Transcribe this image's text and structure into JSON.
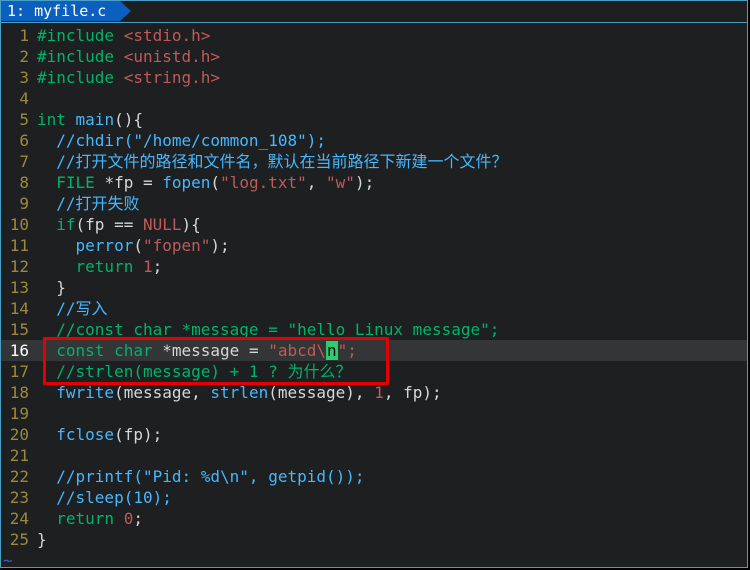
{
  "tab": {
    "label": " 1: myfile.c "
  },
  "gutter": {
    "1": "1",
    "2": "2",
    "3": "3",
    "4": "4",
    "5": "5",
    "6": "6",
    "7": "7",
    "8": "8",
    "9": "9",
    "10": "10",
    "11": "11",
    "12": "12",
    "13": "13",
    "14": "14",
    "15": "15",
    "16": "16",
    "17": "17",
    "18": "18",
    "19": "19",
    "20": "20",
    "21": "21",
    "22": "22",
    "23": "23",
    "24": "24",
    "25": "25"
  },
  "tok": {
    "include": "#include",
    "h_stdio": " <stdio.h>",
    "h_unistd": " <unistd.h>",
    "h_string": " <string.h>",
    "int": "int",
    "main": " main",
    "main_paren": "(){",
    "indent1": "  ",
    "indent2": "    ",
    "c_chdir": "//chdir(\"/home/common_108\");",
    "c_open": "//打开文件的路径和文件名，默认在当前路径下新建一个文件？",
    "file": "FILE",
    "sp": " ",
    "star": "*",
    "fp": "fp",
    "eq": " = ",
    "fopen": "fopen",
    "open_paren": "(",
    "str_log": "\"log.txt\"",
    "comma": ", ",
    "str_w": "\"w\"",
    "close_paren_semi": ");",
    "c_openfail": "//打开失败",
    "if": "if",
    "if_cond_open": "(",
    "fp2": "fp",
    "eqeq": " == ",
    "NULL": "NULL",
    "if_cond_close": "){",
    "perror": "perror",
    "str_fopen": "\"fopen\"",
    "return": "return",
    "one": " 1",
    "semi": ";",
    "brace_close": "}",
    "c_write": "//写入",
    "c_oldmsg": "//const char *message = \"hello Linux message\";",
    "const": "const",
    "char": " char",
    "star2": " *",
    "message": "message",
    "eq2": " = ",
    "str_abcd_open": "\"abcd\\",
    "cursor_n": "n",
    "str_abcd_close": "\";",
    "c_strlen": "//strlen(message) + 1 ? 为什么？",
    "fwrite": "fwrite",
    "fw_open": "(",
    "msg": "message",
    "cm": ", ",
    "strlen": "strlen",
    "sl_open": "(",
    "msg2": "message",
    "sl_close": ")",
    "num1": "1",
    "fp3": "fp",
    "end_paren_semi": ");",
    "fclose": "fclose",
    "fc_open": "(",
    "fp4": "fp",
    "c_printf": "//printf(\"Pid: %d\\n\", getpid());",
    "c_sleep": "//sleep(10);",
    "return0": "return",
    "zero": " 0",
    "final_brace": "}",
    "tilde": "~"
  }
}
